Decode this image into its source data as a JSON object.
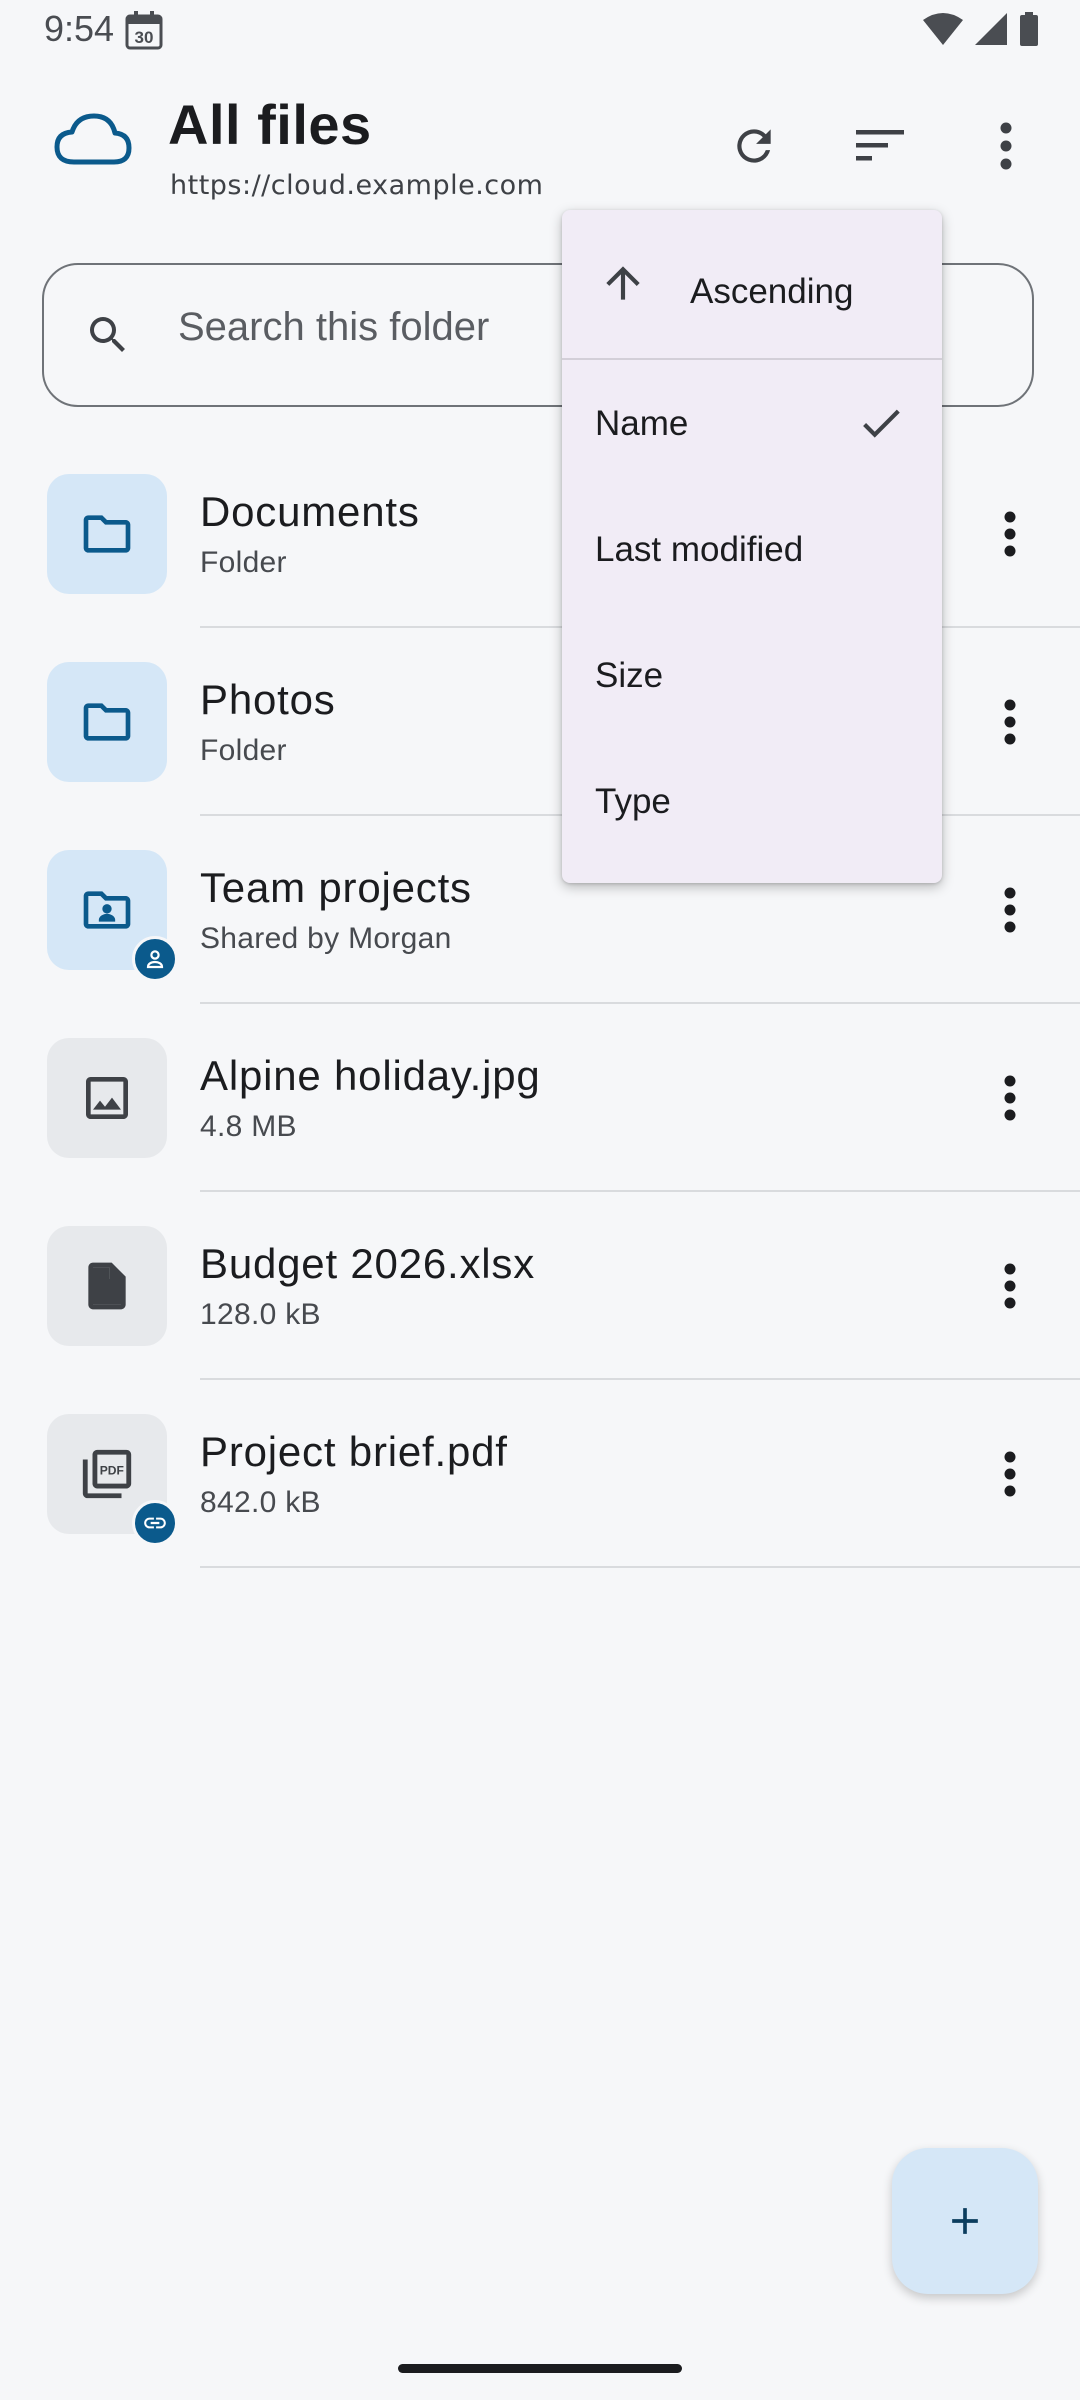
{
  "status_bar": {
    "time": "9:54",
    "calendar_day": "30"
  },
  "app_bar": {
    "title": "All files",
    "subtitle": "https://cloud.example.com",
    "icons": [
      "cloud-icon",
      "refresh-icon",
      "sort-icon",
      "more-vert-icon"
    ]
  },
  "search": {
    "placeholder": "Search this folder",
    "value": ""
  },
  "files": [
    {
      "name": "Documents",
      "meta": "Folder",
      "kind": "folder",
      "icon": "folder-icon",
      "badge": null
    },
    {
      "name": "Photos",
      "meta": "Folder",
      "kind": "folder",
      "icon": "folder-icon",
      "badge": null
    },
    {
      "name": "Team projects",
      "meta": "Shared by Morgan",
      "kind": "folder",
      "icon": "shared-folder-icon",
      "badge": "person-badge-icon"
    },
    {
      "name": "Alpine holiday.jpg",
      "meta": "4.8 MB",
      "kind": "file",
      "icon": "image-icon",
      "badge": null
    },
    {
      "name": "Budget 2026.xlsx",
      "meta": "128.0 kB",
      "kind": "file",
      "icon": "document-icon",
      "badge": null
    },
    {
      "name": "Project brief.pdf",
      "meta": "842.0 kB",
      "kind": "file",
      "icon": "pdf-icon",
      "badge": "link-badge-icon"
    }
  ],
  "sort_menu": {
    "direction_label": "Ascending",
    "options": [
      {
        "label": "Name",
        "selected": true
      },
      {
        "label": "Last modified",
        "selected": false
      },
      {
        "label": "Size",
        "selected": false
      },
      {
        "label": "Type",
        "selected": false
      }
    ]
  },
  "fab": {
    "icon": "add-icon"
  },
  "colors": {
    "accent": "#0b5a8c",
    "background": "#f6f7f9",
    "folder_tile": "#d5e7f7",
    "file_tile": "#e7e9ec",
    "menu_bg": "#f1ecf6"
  }
}
